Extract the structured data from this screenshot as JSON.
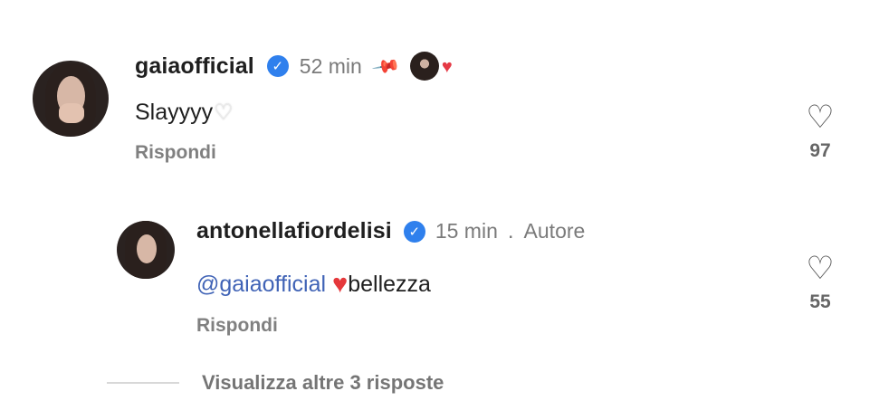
{
  "comments": [
    {
      "username": "gaiaofficial",
      "time": "52 min",
      "text": "Slayyyy",
      "reply_label": "Rispondi",
      "likes": "97",
      "emoji": "white-heart"
    },
    {
      "username": "antonellafiordelisi",
      "time": "15 min",
      "author_label": "Autore",
      "mention": "@gaiaofficial",
      "text": "bellezza",
      "reply_label": "Rispondi",
      "likes": "55",
      "emoji": "red-heart"
    }
  ],
  "view_more": {
    "label": "Visualizza altre 3 risposte"
  },
  "icons": {
    "verified": "verified-badge-icon",
    "pin": "pin-icon",
    "heart_outline": "heart-outline-icon",
    "creator_like": "creator-liked-icon"
  },
  "colors": {
    "verified": "#2f80ed",
    "mention": "#4063b6",
    "red_heart": "#e5383b",
    "secondary_text": "#7a7a7a"
  }
}
